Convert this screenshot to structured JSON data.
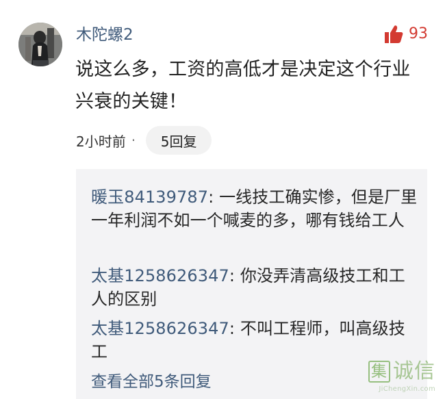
{
  "comment": {
    "username": "木陀螺2",
    "like_count": "93",
    "text": "说这么多，工资的高低才是决定这个行业兴衰的关键！",
    "time": "2小时前",
    "separator": "·",
    "reply_count_label": "5回复",
    "avatar_icon": "user-avatar-photo",
    "like_icon": "thumbs-up-icon"
  },
  "replies": [
    {
      "author": "暖玉84139787",
      "separator": ":",
      "text": " 一线技工确实惨，但是厂里一年利润不如一个喊麦的多，哪有钱给工人"
    },
    {
      "author": "太基1258626347",
      "separator": ":",
      "text": " 你没弄清高级技工和工人的区别"
    },
    {
      "author": "太基1258626347",
      "separator": ":",
      "text": " 不叫工程师，叫高级技工"
    }
  ],
  "view_all_label": "查看全部5条回复",
  "watermark": {
    "box_char": "集",
    "main_text": "诚信",
    "sub_text": "JiChengXin.com"
  },
  "colors": {
    "link_blue": "#3f5a7a",
    "like_red": "#d33a31",
    "reply_background": "#f3f3f5",
    "watermark_green": "#8dba73"
  }
}
